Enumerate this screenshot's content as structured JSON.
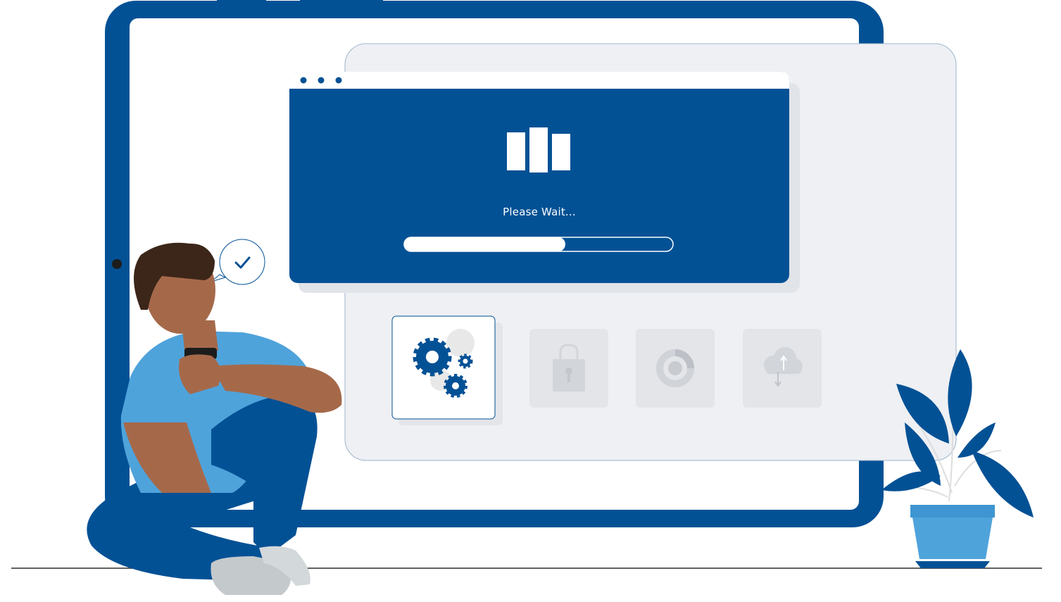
{
  "loading_dialog": {
    "message": "Please Wait...",
    "progress_fraction": 0.6
  },
  "feature_tiles": [
    {
      "icon": "gears-icon",
      "state": "active"
    },
    {
      "icon": "padlock-icon",
      "state": "inactive"
    },
    {
      "icon": "donut-chart-icon",
      "state": "inactive"
    },
    {
      "icon": "cloud-sync-icon",
      "state": "inactive"
    }
  ],
  "speech_bubble": {
    "icon": "checkmark-icon"
  },
  "colors": {
    "brand_blue": "#035195",
    "light_blue": "#4FA3DB",
    "panel_gray": "#EEF0F4",
    "tile_gray": "#E3E5E9",
    "skin": "#A5694A",
    "hair": "#3B2619"
  }
}
